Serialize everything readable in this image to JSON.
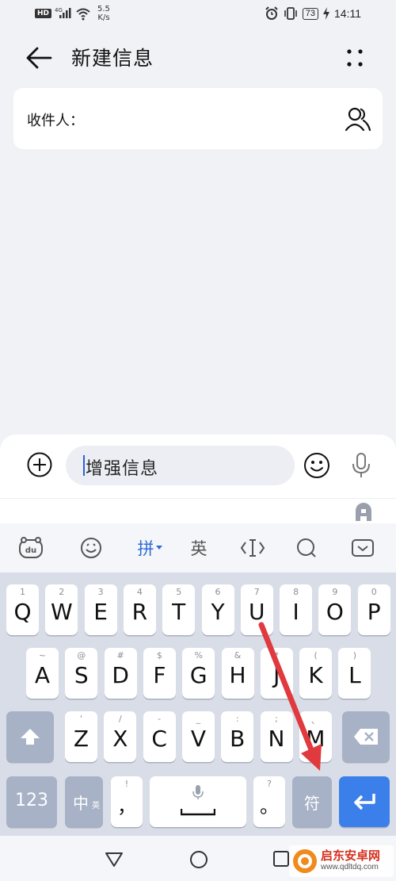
{
  "status_bar": {
    "hd": "HD",
    "network": "4G",
    "speed_value": "5.5",
    "speed_unit": "K/s",
    "battery": "73",
    "time": "14:11"
  },
  "header": {
    "title": "新建信息"
  },
  "recipient": {
    "label": "收件人："
  },
  "compose": {
    "message_text": "增强信息"
  },
  "ime_toolbar": {
    "pinyin_label": "拼",
    "english_label": "英"
  },
  "keyboard": {
    "row1": [
      {
        "sub": "1",
        "main": "Q"
      },
      {
        "sub": "2",
        "main": "W"
      },
      {
        "sub": "3",
        "main": "E"
      },
      {
        "sub": "4",
        "main": "R"
      },
      {
        "sub": "5",
        "main": "T"
      },
      {
        "sub": "6",
        "main": "Y"
      },
      {
        "sub": "7",
        "main": "U"
      },
      {
        "sub": "8",
        "main": "I"
      },
      {
        "sub": "9",
        "main": "O"
      },
      {
        "sub": "0",
        "main": "P"
      }
    ],
    "row2": [
      {
        "sub": "~",
        "main": "A"
      },
      {
        "sub": "@",
        "main": "S"
      },
      {
        "sub": "#",
        "main": "D"
      },
      {
        "sub": "$",
        "main": "F"
      },
      {
        "sub": "%",
        "main": "G"
      },
      {
        "sub": "&",
        "main": "H"
      },
      {
        "sub": "*",
        "main": "J"
      },
      {
        "sub": "(",
        "main": "K"
      },
      {
        "sub": ")",
        "main": "L"
      }
    ],
    "row3": [
      {
        "sub": "'",
        "main": "Z"
      },
      {
        "sub": "/",
        "main": "X"
      },
      {
        "sub": "-",
        "main": "C"
      },
      {
        "sub": "_",
        "main": "V"
      },
      {
        "sub": ":",
        "main": "B"
      },
      {
        "sub": ";",
        "main": "N"
      },
      {
        "sub": "、",
        "main": "M"
      }
    ],
    "num_key": "123",
    "cn_key": "中",
    "cn_key_sub": "英",
    "comma_sub": "!",
    "comma_main": "，",
    "period_sub": "?",
    "period_main": "。",
    "symbol_key": "符"
  },
  "watermark": {
    "brand": "启东安卓网",
    "url": "www.qdltdq.com"
  },
  "colors": {
    "accent_blue": "#3b80ea",
    "pinyin_blue": "#2d6bd6",
    "annotation_arrow": "#e0393e",
    "function_key": "#a7b2c7"
  }
}
